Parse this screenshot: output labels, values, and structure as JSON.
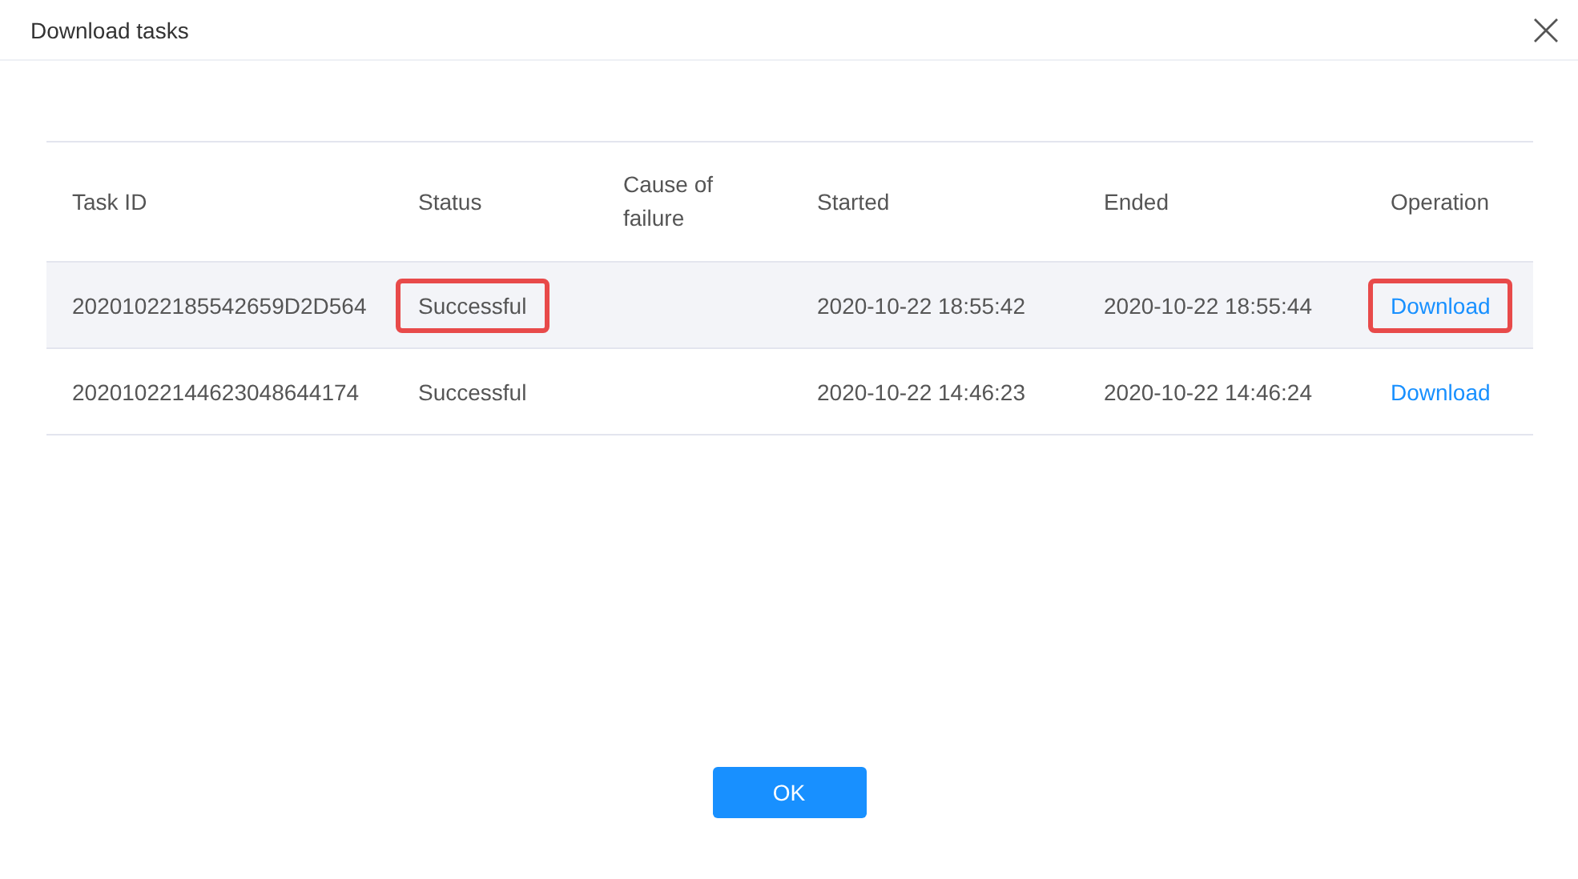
{
  "dialog": {
    "title": "Download tasks",
    "ok_button": "OK"
  },
  "table": {
    "columns": [
      "Task ID",
      "Status",
      "Cause of failure",
      "Started",
      "Ended",
      "Operation"
    ],
    "rows": [
      {
        "task_id": "20201022185542659D2D564",
        "status": "Successful",
        "cause": "",
        "started": "2020-10-22 18:55:42",
        "ended": "2020-10-22 18:55:44",
        "operation": "Download",
        "hovered": true,
        "highlighted": true
      },
      {
        "task_id": "20201022144623048644174",
        "status": "Successful",
        "cause": "",
        "started": "2020-10-22 14:46:23",
        "ended": "2020-10-22 14:46:24",
        "operation": "Download",
        "hovered": false,
        "highlighted": false
      }
    ]
  }
}
